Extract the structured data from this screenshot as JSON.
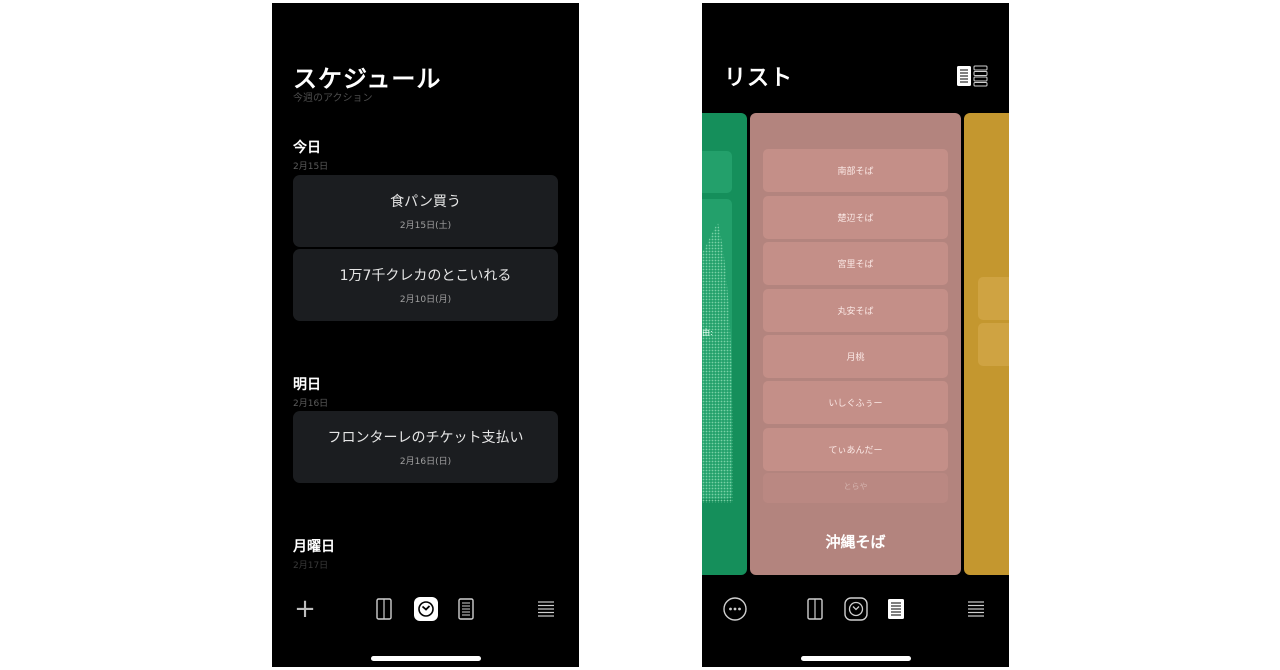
{
  "schedule": {
    "title": "スケジュール",
    "subtitle": "今週のアクション",
    "sections": [
      {
        "label": "今日",
        "date": "2月15日"
      },
      {
        "label": "明日",
        "date": "2月16日"
      },
      {
        "label": "月曜日",
        "date": "2月17日"
      }
    ],
    "cards": [
      {
        "title": "食パン買う",
        "date": "2月15日(土)"
      },
      {
        "title": "1万7千クレカのとこいれる",
        "date": "2月10日(月)"
      },
      {
        "title": "フロンターレのチケット支払い",
        "date": "2月16日(日)"
      }
    ]
  },
  "list": {
    "title": "リスト",
    "green_partial_text": "由:",
    "items": [
      "南部そば",
      "楚辺そば",
      "宮里そば",
      "丸安そば",
      "月桃",
      "いしぐふぅー",
      "てぃあんだー",
      "とらや"
    ],
    "column_name": "沖縄そば"
  },
  "icons": {
    "add": "plus-icon",
    "more": "more-icon",
    "board": "board-view-icon",
    "clock": "clock-icon",
    "list": "list-view-icon",
    "menu": "menu-icon",
    "view_toggle": "view-toggle-icon"
  },
  "colors": {
    "green": "#158f5b",
    "pink": "#b3847e",
    "yellow": "#c4972f"
  },
  "tabs": {
    "plus_label": "+"
  }
}
